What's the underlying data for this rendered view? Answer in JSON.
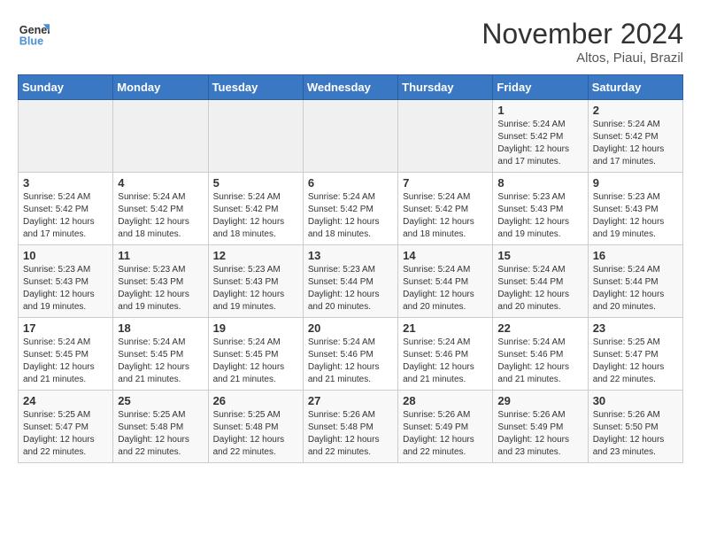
{
  "logo": {
    "line1": "General",
    "line2": "Blue"
  },
  "title": "November 2024",
  "subtitle": "Altos, Piaui, Brazil",
  "days_of_week": [
    "Sunday",
    "Monday",
    "Tuesday",
    "Wednesday",
    "Thursday",
    "Friday",
    "Saturday"
  ],
  "weeks": [
    [
      {
        "day": "",
        "info": ""
      },
      {
        "day": "",
        "info": ""
      },
      {
        "day": "",
        "info": ""
      },
      {
        "day": "",
        "info": ""
      },
      {
        "day": "",
        "info": ""
      },
      {
        "day": "1",
        "info": "Sunrise: 5:24 AM\nSunset: 5:42 PM\nDaylight: 12 hours and 17 minutes."
      },
      {
        "day": "2",
        "info": "Sunrise: 5:24 AM\nSunset: 5:42 PM\nDaylight: 12 hours and 17 minutes."
      }
    ],
    [
      {
        "day": "3",
        "info": "Sunrise: 5:24 AM\nSunset: 5:42 PM\nDaylight: 12 hours and 17 minutes."
      },
      {
        "day": "4",
        "info": "Sunrise: 5:24 AM\nSunset: 5:42 PM\nDaylight: 12 hours and 18 minutes."
      },
      {
        "day": "5",
        "info": "Sunrise: 5:24 AM\nSunset: 5:42 PM\nDaylight: 12 hours and 18 minutes."
      },
      {
        "day": "6",
        "info": "Sunrise: 5:24 AM\nSunset: 5:42 PM\nDaylight: 12 hours and 18 minutes."
      },
      {
        "day": "7",
        "info": "Sunrise: 5:24 AM\nSunset: 5:42 PM\nDaylight: 12 hours and 18 minutes."
      },
      {
        "day": "8",
        "info": "Sunrise: 5:23 AM\nSunset: 5:43 PM\nDaylight: 12 hours and 19 minutes."
      },
      {
        "day": "9",
        "info": "Sunrise: 5:23 AM\nSunset: 5:43 PM\nDaylight: 12 hours and 19 minutes."
      }
    ],
    [
      {
        "day": "10",
        "info": "Sunrise: 5:23 AM\nSunset: 5:43 PM\nDaylight: 12 hours and 19 minutes."
      },
      {
        "day": "11",
        "info": "Sunrise: 5:23 AM\nSunset: 5:43 PM\nDaylight: 12 hours and 19 minutes."
      },
      {
        "day": "12",
        "info": "Sunrise: 5:23 AM\nSunset: 5:43 PM\nDaylight: 12 hours and 19 minutes."
      },
      {
        "day": "13",
        "info": "Sunrise: 5:23 AM\nSunset: 5:44 PM\nDaylight: 12 hours and 20 minutes."
      },
      {
        "day": "14",
        "info": "Sunrise: 5:24 AM\nSunset: 5:44 PM\nDaylight: 12 hours and 20 minutes."
      },
      {
        "day": "15",
        "info": "Sunrise: 5:24 AM\nSunset: 5:44 PM\nDaylight: 12 hours and 20 minutes."
      },
      {
        "day": "16",
        "info": "Sunrise: 5:24 AM\nSunset: 5:44 PM\nDaylight: 12 hours and 20 minutes."
      }
    ],
    [
      {
        "day": "17",
        "info": "Sunrise: 5:24 AM\nSunset: 5:45 PM\nDaylight: 12 hours and 21 minutes."
      },
      {
        "day": "18",
        "info": "Sunrise: 5:24 AM\nSunset: 5:45 PM\nDaylight: 12 hours and 21 minutes."
      },
      {
        "day": "19",
        "info": "Sunrise: 5:24 AM\nSunset: 5:45 PM\nDaylight: 12 hours and 21 minutes."
      },
      {
        "day": "20",
        "info": "Sunrise: 5:24 AM\nSunset: 5:46 PM\nDaylight: 12 hours and 21 minutes."
      },
      {
        "day": "21",
        "info": "Sunrise: 5:24 AM\nSunset: 5:46 PM\nDaylight: 12 hours and 21 minutes."
      },
      {
        "day": "22",
        "info": "Sunrise: 5:24 AM\nSunset: 5:46 PM\nDaylight: 12 hours and 21 minutes."
      },
      {
        "day": "23",
        "info": "Sunrise: 5:25 AM\nSunset: 5:47 PM\nDaylight: 12 hours and 22 minutes."
      }
    ],
    [
      {
        "day": "24",
        "info": "Sunrise: 5:25 AM\nSunset: 5:47 PM\nDaylight: 12 hours and 22 minutes."
      },
      {
        "day": "25",
        "info": "Sunrise: 5:25 AM\nSunset: 5:48 PM\nDaylight: 12 hours and 22 minutes."
      },
      {
        "day": "26",
        "info": "Sunrise: 5:25 AM\nSunset: 5:48 PM\nDaylight: 12 hours and 22 minutes."
      },
      {
        "day": "27",
        "info": "Sunrise: 5:26 AM\nSunset: 5:48 PM\nDaylight: 12 hours and 22 minutes."
      },
      {
        "day": "28",
        "info": "Sunrise: 5:26 AM\nSunset: 5:49 PM\nDaylight: 12 hours and 22 minutes."
      },
      {
        "day": "29",
        "info": "Sunrise: 5:26 AM\nSunset: 5:49 PM\nDaylight: 12 hours and 23 minutes."
      },
      {
        "day": "30",
        "info": "Sunrise: 5:26 AM\nSunset: 5:50 PM\nDaylight: 12 hours and 23 minutes."
      }
    ]
  ]
}
